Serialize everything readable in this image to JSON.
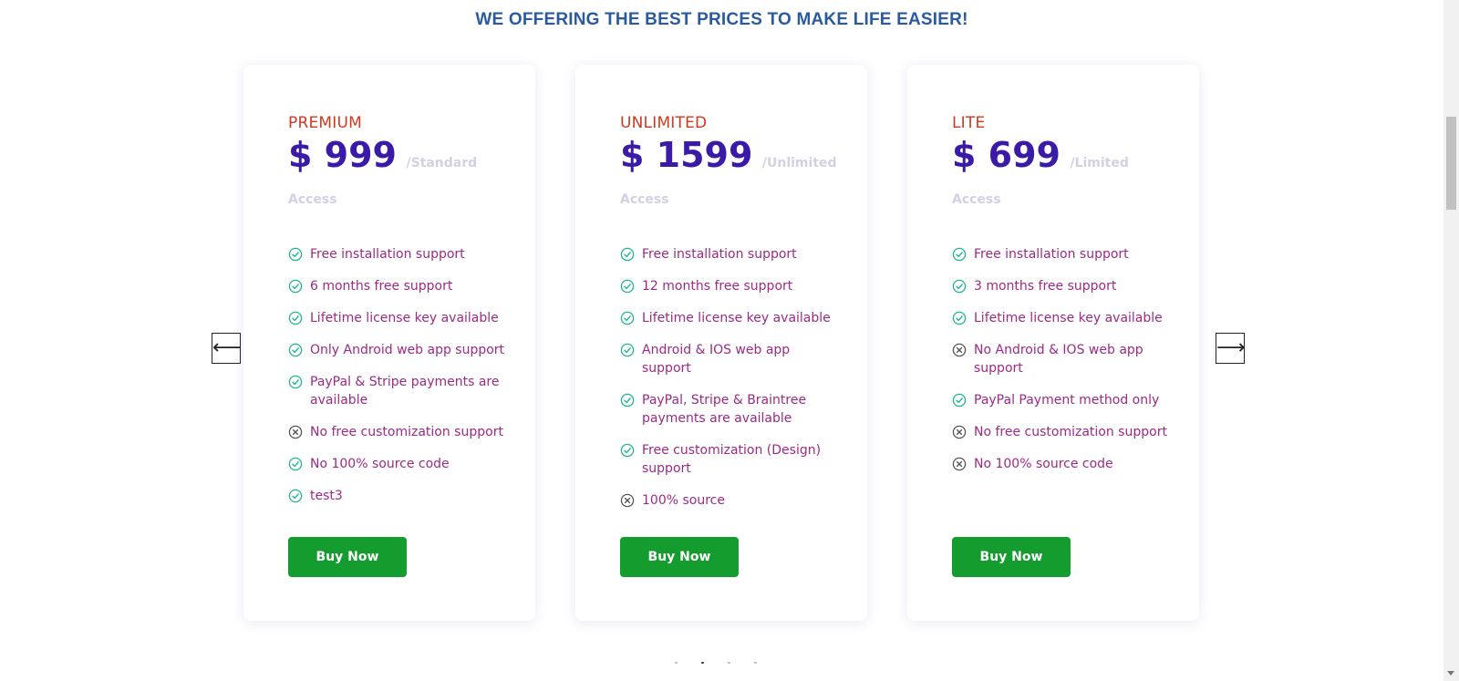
{
  "headline": "WE OFFERING THE BEST PRICES TO MAKE LIFE EASIER!",
  "icons": {
    "included": "check-circle-icon",
    "excluded": "x-circle-icon"
  },
  "colors": {
    "plan_name": "#d0391e",
    "price": "#3c1aa8",
    "feature_text": "#9c2a86",
    "check": "#1fb58f",
    "cross": "#555555",
    "button": "#159c2e",
    "headline": "#2a5b9e"
  },
  "carousel": {
    "prev_label": "⟵",
    "next_label": "⟶",
    "dots": 4,
    "active_dot": 1
  },
  "plans": [
    {
      "name": "PREMIUM",
      "price": "$ 999",
      "period": "/Standard Access",
      "button": "Buy Now",
      "features": [
        {
          "text": "Free installation support",
          "included": true
        },
        {
          "text": "6 months free support",
          "included": true
        },
        {
          "text": "Lifetime license key available",
          "included": true
        },
        {
          "text": "Only Android web app support",
          "included": true
        },
        {
          "text": "PayPal & Stripe payments are available",
          "included": true
        },
        {
          "text": "No free customization support",
          "included": false
        },
        {
          "text": "No 100% source code",
          "included": true
        },
        {
          "text": "test3",
          "included": true
        }
      ]
    },
    {
      "name": "UNLIMITED",
      "price": "$ 1599",
      "period": "/Unlimited Access",
      "button": "Buy Now",
      "features": [
        {
          "text": "Free installation support",
          "included": true
        },
        {
          "text": "12 months free support",
          "included": true
        },
        {
          "text": "Lifetime license key available",
          "included": true
        },
        {
          "text": "Android & IOS web app support",
          "included": true
        },
        {
          "text": "PayPal, Stripe & Braintree payments are available",
          "included": true
        },
        {
          "text": "Free customization (Design) support",
          "included": true
        },
        {
          "text": "100% source",
          "included": false
        }
      ]
    },
    {
      "name": "LITE",
      "price": "$ 699",
      "period": "/Limited Access",
      "button": "Buy Now",
      "features": [
        {
          "text": "Free installation support",
          "included": true
        },
        {
          "text": "3 months free support",
          "included": true
        },
        {
          "text": "Lifetime license key available",
          "included": true
        },
        {
          "text": "No Android & IOS web app support",
          "included": false
        },
        {
          "text": "PayPal Payment method only",
          "included": true
        },
        {
          "text": "No free customization support",
          "included": false
        },
        {
          "text": "No 100% source code",
          "included": false
        }
      ]
    }
  ]
}
